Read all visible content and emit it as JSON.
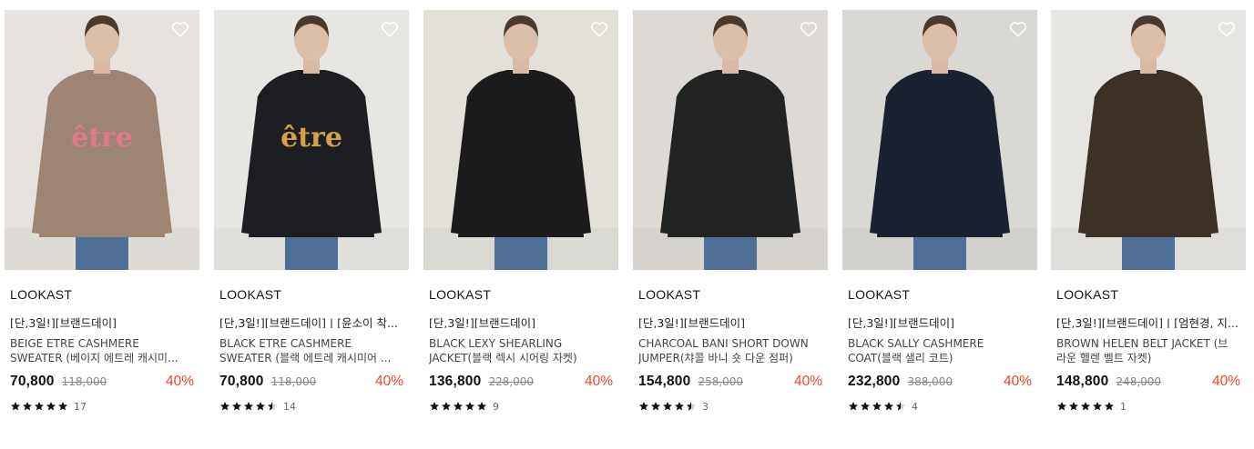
{
  "products": [
    {
      "brand": "LOOKAST",
      "tag": "[단,3일!][브랜드데이]",
      "name_line1": "BEIGE ETRE CASHMERE",
      "name_line2": "SWEATER (베이지 에트레 캐시미...",
      "price": "70,800",
      "original_price": "118,000",
      "discount": "40%",
      "rating": 5,
      "review_count": "17",
      "bg": "#e6e3de",
      "garment": "#9c8572",
      "logo_text": "être",
      "logo_color": "#e07a86"
    },
    {
      "brand": "LOOKAST",
      "tag": "[단,3일!][브랜드데이] | [윤소이 착...",
      "name_line1": "BLACK ETRE CASHMERE",
      "name_line2": "SWEATER (블랙 에트레 캐시미어 ...",
      "price": "70,800",
      "original_price": "118,000",
      "discount": "40%",
      "rating": 4.5,
      "review_count": "14",
      "bg": "#e8e6e2",
      "garment": "#1d1e22",
      "logo_text": "être",
      "logo_color": "#d4a04a"
    },
    {
      "brand": "LOOKAST",
      "tag": "[단,3일!][브랜드데이]",
      "name_line1": "BLACK LEXY SHEARLING",
      "name_line2": "JACKET(블랙 렉시 시어링 자켓)",
      "price": "136,800",
      "original_price": "228,000",
      "discount": "40%",
      "rating": 5,
      "review_count": "9",
      "bg": "#e3e0da",
      "garment": "#1b1b1d",
      "logo_text": "",
      "logo_color": ""
    },
    {
      "brand": "LOOKAST",
      "tag": "[단,3일!][브랜드데이]",
      "name_line1": "CHARCOAL BANI SHORT DOWN",
      "name_line2": "JUMPER(챠콜 바니 숏 다운 점퍼)",
      "price": "154,800",
      "original_price": "258,000",
      "discount": "40%",
      "rating": 4.5,
      "review_count": "3",
      "bg": "#dddad5",
      "garment": "#222323",
      "logo_text": "",
      "logo_color": ""
    },
    {
      "brand": "LOOKAST",
      "tag": "[단,3일!][브랜드데이]",
      "name_line1": "BLACK SALLY CASHMERE",
      "name_line2": "COAT(블랙 샐리 코트)",
      "price": "232,800",
      "original_price": "388,000",
      "discount": "40%",
      "rating": 4.5,
      "review_count": "4",
      "bg": "#d9d8d5",
      "garment": "#1a2230",
      "logo_text": "",
      "logo_color": ""
    },
    {
      "brand": "LOOKAST",
      "tag": "[단,3일!][브랜드데이] | [엄현경, 지...",
      "name_line1": "BROWN HELEN BELT JACKET (브",
      "name_line2": "라운 헬렌 벨트 자켓)",
      "price": "148,800",
      "original_price": "248,000",
      "discount": "40%",
      "rating": 5,
      "review_count": "1",
      "bg": "#e7e5e1",
      "garment": "#3b3127",
      "logo_text": "",
      "logo_color": ""
    }
  ],
  "colors": {
    "discount": "#f0452a",
    "star": "#111111"
  },
  "icons": {
    "wishlist": "heart-outline-icon",
    "star": "star-icon"
  }
}
